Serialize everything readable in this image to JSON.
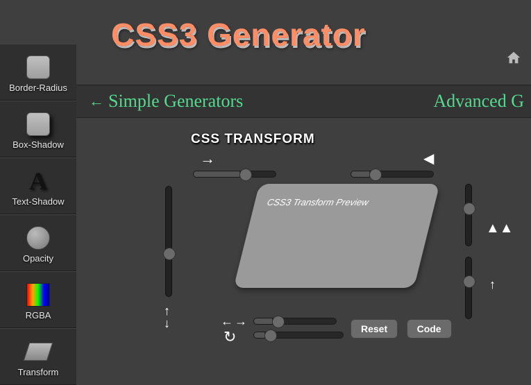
{
  "app": {
    "title": "CSS3 Generator"
  },
  "subnav": {
    "left": "Simple Generators",
    "right": "Advanced G"
  },
  "section": {
    "title": "CSS TRANSFORM"
  },
  "sidebar": {
    "items": [
      {
        "label": "Border-Radius"
      },
      {
        "label": "Box-Shadow"
      },
      {
        "label": "Text-Shadow"
      },
      {
        "label": "Opacity"
      },
      {
        "label": "RGBA"
      },
      {
        "label": "Transform"
      }
    ]
  },
  "preview": {
    "label": "CSS3 Transform Preview"
  },
  "buttons": {
    "reset": "Reset",
    "code": "Code"
  },
  "icons": {
    "text_shadow_letter": "A"
  }
}
